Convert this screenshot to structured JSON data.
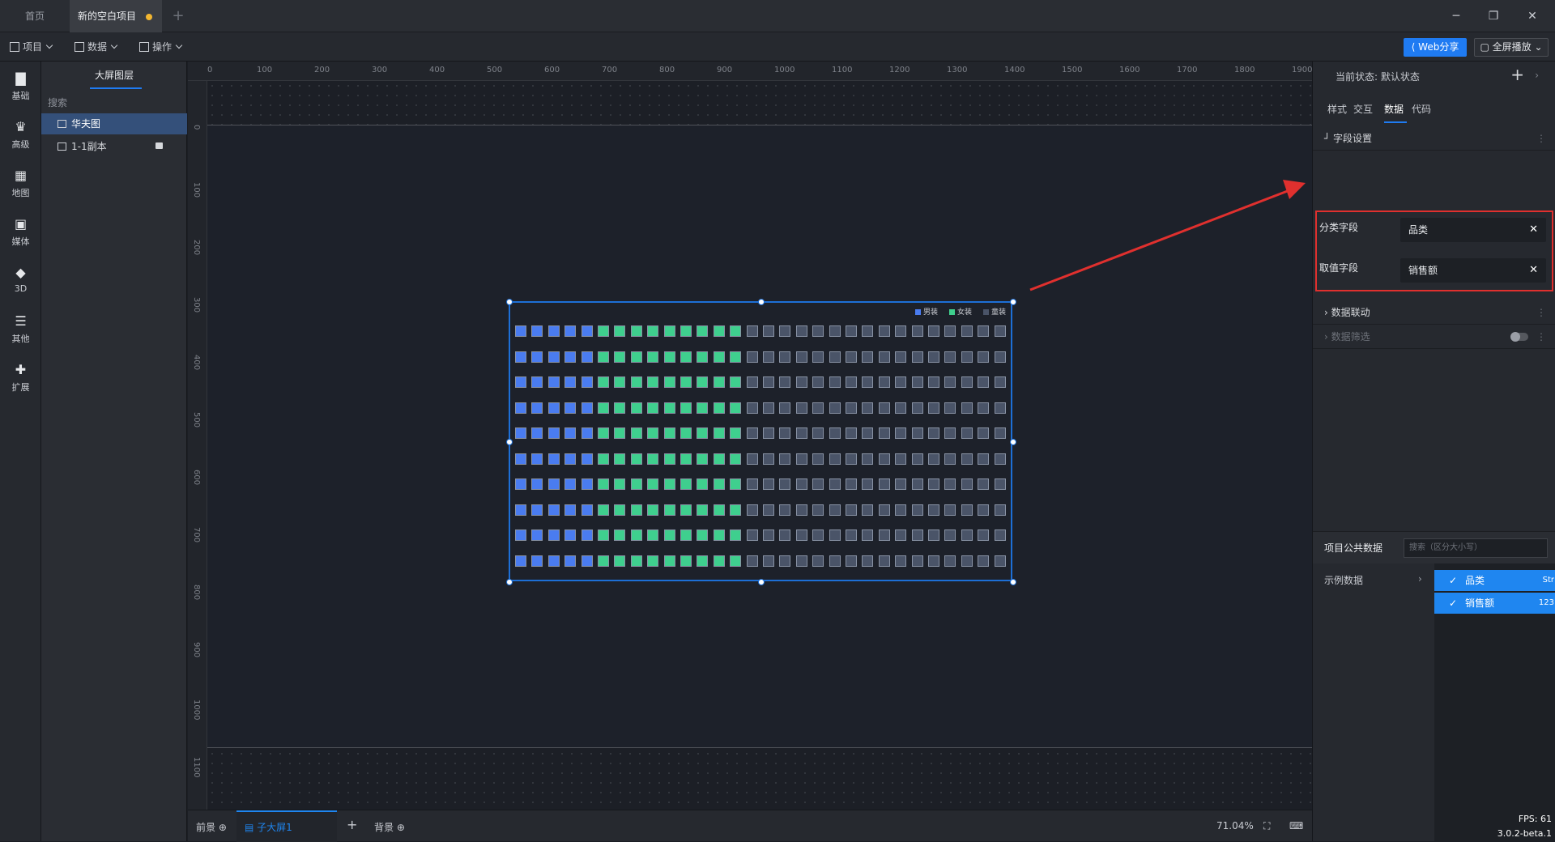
{
  "titlebar": {
    "tabs": [
      {
        "label": "首页"
      },
      {
        "label": "新的空白项目"
      }
    ],
    "add": "+",
    "min": "─",
    "restore": "❐",
    "close": "✕"
  },
  "toolbar": {
    "menus": [
      {
        "label": "项目"
      },
      {
        "label": "数据"
      },
      {
        "label": "操作"
      }
    ],
    "web_share": "Web分享",
    "fullscreen": "全屏播放"
  },
  "leftnav": {
    "items": [
      {
        "label": "基础",
        "icon": "bar-chart-icon",
        "glyph": "▇"
      },
      {
        "label": "高级",
        "icon": "crown-icon",
        "glyph": "♛"
      },
      {
        "label": "地图",
        "icon": "map-icon",
        "glyph": "▦"
      },
      {
        "label": "媒体",
        "icon": "camera-icon",
        "glyph": "▣"
      },
      {
        "label": "3D",
        "icon": "cube-icon",
        "glyph": "◆"
      },
      {
        "label": "其他",
        "icon": "list-icon",
        "glyph": "☰"
      },
      {
        "label": "扩展",
        "icon": "puzzle-icon",
        "glyph": "✚"
      }
    ]
  },
  "layers": {
    "title": "大屏图层",
    "search_placeholder": "搜索",
    "items": [
      {
        "label": "华夫图",
        "selected": true
      },
      {
        "label": "1-1副本",
        "locked": true
      }
    ]
  },
  "rulers": {
    "top": [
      "0",
      "100",
      "200",
      "300",
      "400",
      "500",
      "600",
      "700",
      "800",
      "900",
      "1000",
      "1100",
      "1200",
      "1300",
      "1400",
      "1500",
      "1600",
      "1700",
      "1800",
      "1900"
    ],
    "left": [
      "0",
      "100",
      "200",
      "300",
      "400",
      "500",
      "600",
      "700",
      "800",
      "900",
      "1000",
      "1100"
    ]
  },
  "chart_data": {
    "type": "waffle",
    "legend": [
      "男装",
      "女装",
      "童装"
    ],
    "colors": [
      "#4a7cf0",
      "#3fcf8e",
      "#4a5468"
    ],
    "rows": 10,
    "columns": 30,
    "cells_per_row": [
      5,
      9,
      16
    ]
  },
  "rightpanel": {
    "state_label": "当前状态:",
    "state_value": "默认状态",
    "tabs": [
      {
        "label": "样式"
      },
      {
        "label": "交互"
      },
      {
        "label": "数据",
        "active": true
      },
      {
        "label": "代码"
      }
    ],
    "field_settings": "字段设置",
    "category_label": "分类字段",
    "category_value": "品类",
    "value_label": "取值字段",
    "value_value": "销售额",
    "data_link": "数据联动",
    "data_filter": "数据筛选",
    "public_data": "项目公共数据",
    "public_search_placeholder": "搜索（区分大小写）",
    "dataset": "示例数据",
    "fields": [
      {
        "label": "品类",
        "type": "Str"
      },
      {
        "label": "销售额",
        "type": "123"
      }
    ]
  },
  "bottombar": {
    "foreground": "前景",
    "sub_screen": "子大屏1",
    "add": "+",
    "background": "背景",
    "zoom": "71.04%",
    "fps": "FPS: 61",
    "version": "3.0.2-beta.1"
  }
}
